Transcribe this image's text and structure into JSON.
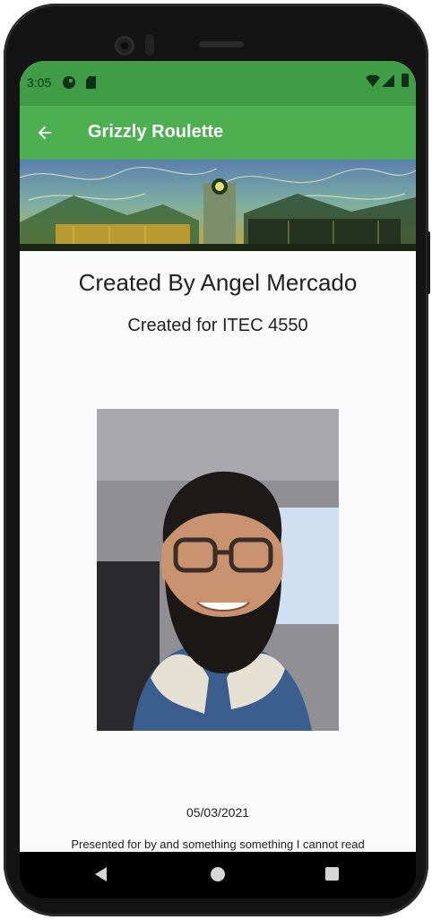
{
  "status_bar": {
    "time": "3:05",
    "icons": [
      "sync-icon",
      "sd-card-icon",
      "wifi-icon",
      "signal-icon",
      "battery-icon"
    ]
  },
  "app_bar": {
    "title": "Grizzly Roulette",
    "back_icon": "arrow-left-icon",
    "color": "#4caf50",
    "status_color": "#3f9e45"
  },
  "content": {
    "created_by": "Created By Angel Mercado",
    "created_for": "Created for ITEC 4550",
    "date": "05/03/2021",
    "presented_text": "Presented for by and something something I cannot read"
  },
  "nav_bar": {
    "buttons": [
      "back-triangle-icon",
      "home-circle-icon",
      "recents-square-icon"
    ]
  }
}
